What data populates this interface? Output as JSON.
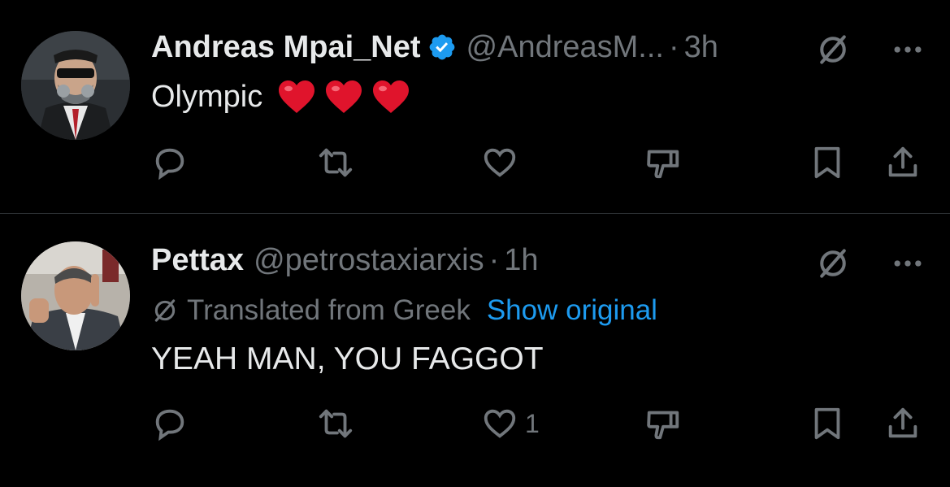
{
  "tweets": [
    {
      "author_name": "Andreas Mpai_Net",
      "verified": true,
      "handle": "@AndreasM...",
      "dot": "·",
      "time": "3h",
      "text": "Olympic",
      "emoji": [
        "❤️",
        "❤️",
        "❤️"
      ],
      "reply_count": "",
      "retweet_count": "",
      "like_count": ""
    },
    {
      "author_name": "Pettax",
      "verified": false,
      "handle": "@petrostaxiarxis",
      "dot": "·",
      "time": "1h",
      "translated_label": "Translated from Greek",
      "show_original": "Show original",
      "text": "YEAH MAN, YOU FAGGOT",
      "reply_count": "",
      "retweet_count": "",
      "like_count": "1"
    }
  ],
  "colors": {
    "background": "#000000",
    "text_primary": "#e7e9ea",
    "text_secondary": "#71767b",
    "link": "#1d9bf0",
    "verified_badge": "#1d9bf0",
    "heart_emoji": "#e0142c",
    "divider": "#2f3336"
  },
  "icons": [
    "reply-icon",
    "retweet-icon",
    "like-icon",
    "dislike-icon",
    "bookmark-icon",
    "share-icon",
    "grok-icon",
    "more-icon",
    "verified-icon",
    "translate-icon"
  ]
}
